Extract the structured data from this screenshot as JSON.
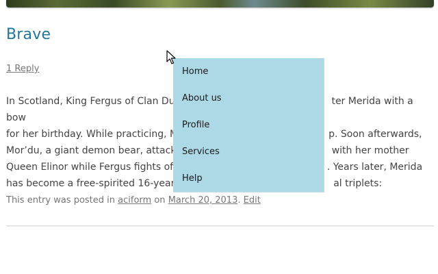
{
  "post": {
    "title": "Brave",
    "comments_link": "1 Reply",
    "content_lines": [
      "In Scotland, King Fergus of Clan Dun",
      "ter Merida with a bow",
      "for her birthday. While practicing, M",
      "p. Soon afterwards,",
      "Mor’du, a giant demon bear, attacks",
      "with her mother",
      "Queen Elinor while Fergus fights off",
      ". Years later, Merida",
      "has become a free-spirited 16-year-c",
      "al triplets:"
    ],
    "meta": {
      "prefix": "This entry was posted in",
      "category": "aciform",
      "on_text": "on",
      "date": "March 20, 2013",
      "period": ".",
      "edit_link": "Edit"
    }
  },
  "dropdown": {
    "items": [
      "Home",
      "About us",
      "Profile",
      "Services",
      "Help"
    ],
    "background": "#add8e6"
  },
  "colors": {
    "title_link": "#21759b",
    "body_text": "#444444",
    "meta_text": "#757575"
  },
  "icons": {
    "cursor": "mouse-pointer-icon"
  }
}
